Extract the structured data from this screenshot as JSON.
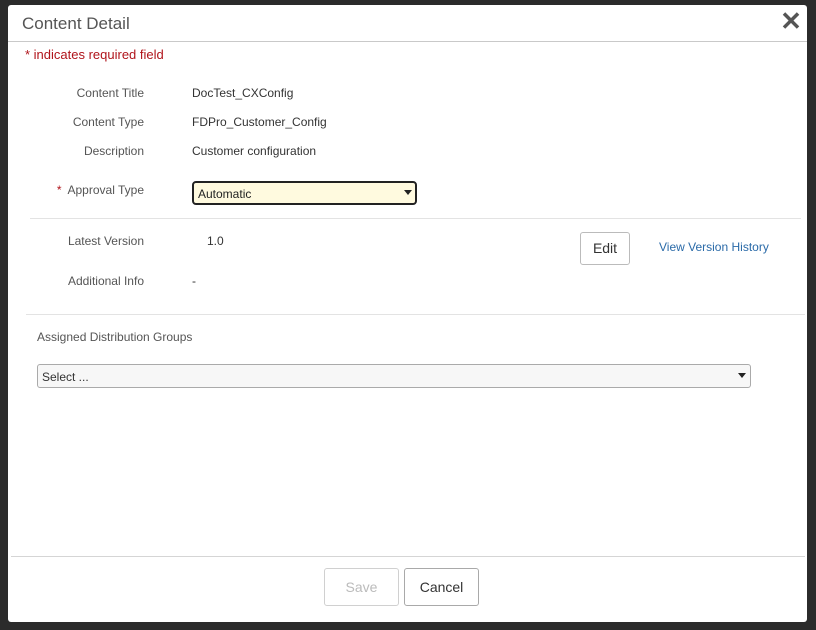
{
  "modal": {
    "title": "Content Detail",
    "close_icon": "close-icon",
    "required_note": "* indicates required field"
  },
  "fields": {
    "content_title": {
      "label": "Content Title",
      "value": "DocTest_CXConfig"
    },
    "content_type": {
      "label": "Content Type",
      "value": "FDPro_Customer_Config"
    },
    "description": {
      "label": "Description",
      "value": "Customer configuration"
    },
    "approval_type": {
      "required_mark": "*",
      "label": "Approval Type",
      "value": "Automatic"
    }
  },
  "version": {
    "latest_label": "Latest Version",
    "latest_value": "1.0",
    "edit_label": "Edit",
    "history_link": "View Version History",
    "additional_label": "Additional Info",
    "additional_value": "-"
  },
  "distribution": {
    "title": "Assigned Distribution Groups",
    "select_value": "Select ..."
  },
  "footer": {
    "save_label": "Save",
    "cancel_label": "Cancel"
  },
  "colors": {
    "required": "#b0141b",
    "link": "#2a6aa8",
    "select_highlight": "#fffadf"
  }
}
